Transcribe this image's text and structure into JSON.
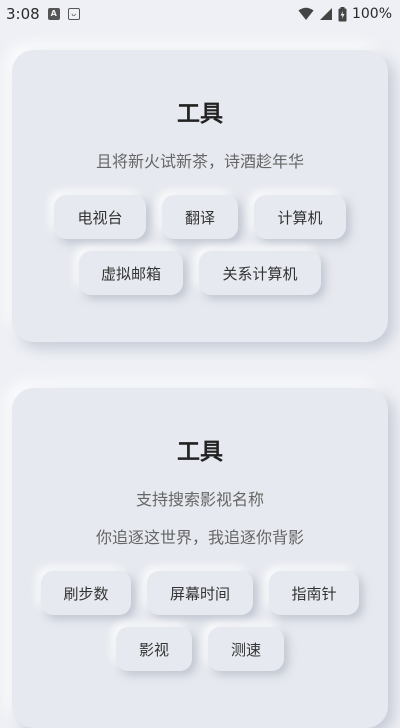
{
  "status_bar": {
    "time": "3:08",
    "notif_icons": [
      "a-icon",
      "cat-icon"
    ],
    "battery": "100%"
  },
  "cards": [
    {
      "title": "工具",
      "subtitles": [
        "且将新火试新茶，诗酒趁年华"
      ],
      "rows": [
        [
          "电视台",
          "翻译",
          "计算机"
        ],
        [
          "虚拟邮箱",
          "关系计算机"
        ]
      ]
    },
    {
      "title": "工具",
      "subtitles": [
        "支持搜索影视名称",
        "你追逐这世界，我追逐你背影"
      ],
      "rows": [
        [
          "刷步数",
          "屏幕时间",
          "指南针"
        ],
        [
          "影视",
          "测速"
        ]
      ]
    }
  ]
}
